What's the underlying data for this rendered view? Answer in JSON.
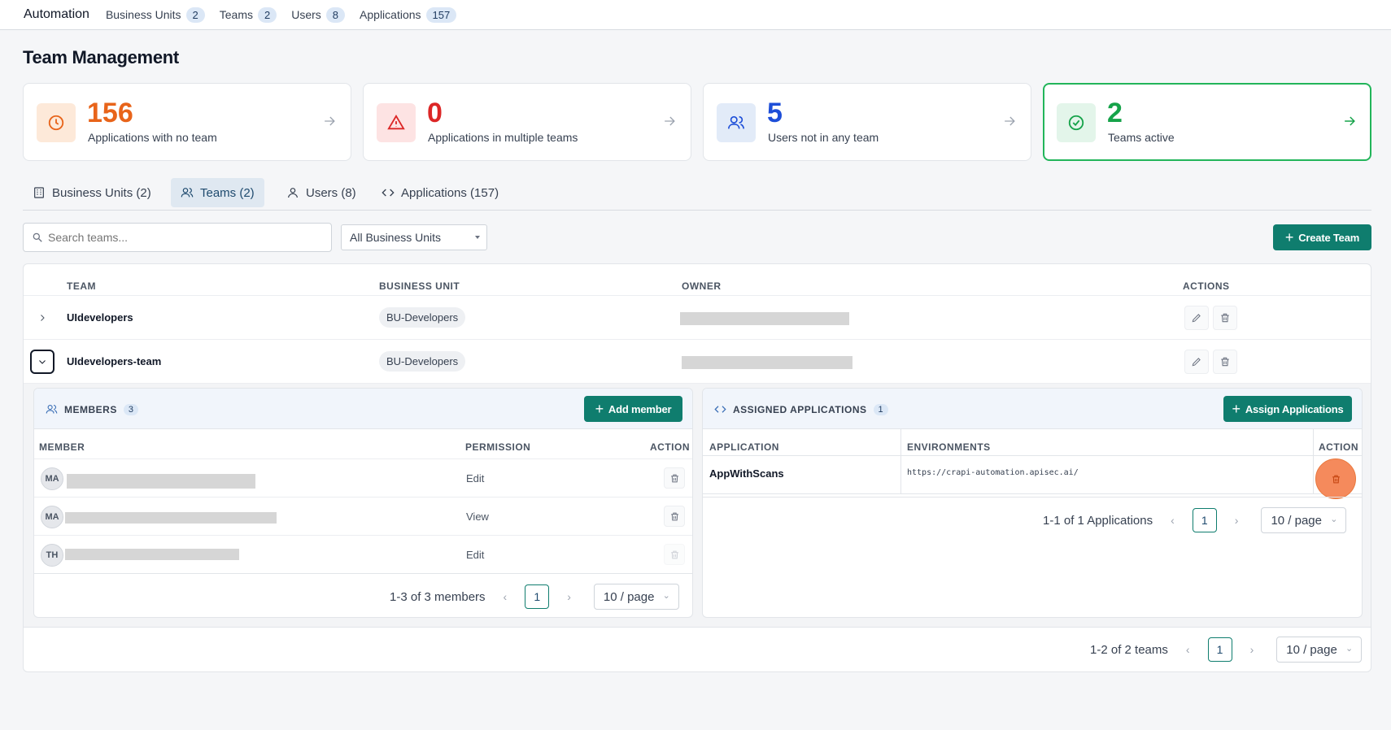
{
  "topnav": {
    "app_title": "Automation",
    "items": [
      {
        "label": "Business Units",
        "count": "2"
      },
      {
        "label": "Teams",
        "count": "2"
      },
      {
        "label": "Users",
        "count": "8"
      },
      {
        "label": "Applications",
        "count": "157"
      }
    ]
  },
  "page": {
    "title": "Team Management"
  },
  "stats": [
    {
      "value": "156",
      "label": "Applications with no team",
      "color": "#e8641a",
      "icon": "clock-icon"
    },
    {
      "value": "0",
      "label": "Applications in multiple teams",
      "color": "#dc2626",
      "icon": "warning-triangle-icon"
    },
    {
      "value": "5",
      "label": "Users not in any team",
      "color": "#1d4ed8",
      "icon": "users-icon"
    },
    {
      "value": "2",
      "label": "Teams active",
      "color": "#16a34a",
      "icon": "check-circle-icon"
    }
  ],
  "tabs": [
    {
      "label": "Business Units (2)",
      "icon": "building-icon"
    },
    {
      "label": "Teams (2)",
      "icon": "users-icon",
      "active": true
    },
    {
      "label": "Users (8)",
      "icon": "user-icon"
    },
    {
      "label": "Applications (157)",
      "icon": "code-icon"
    }
  ],
  "filters": {
    "search_placeholder": "Search teams...",
    "business_unit_selected": "All Business Units",
    "create_label": "Create Team"
  },
  "table": {
    "headers": {
      "team": "TEAM",
      "business_unit": "BUSINESS UNIT",
      "owner": "OWNER",
      "actions": "ACTIONS"
    },
    "rows": [
      {
        "team": "UIdevelopers",
        "business_unit": "BU-Developers",
        "expanded": false
      },
      {
        "team": "UIdevelopers-team",
        "business_unit": "BU-Developers",
        "expanded": true
      }
    ]
  },
  "members": {
    "title": "MEMBERS",
    "count": "3",
    "add_label": "Add member",
    "headers": {
      "member": "MEMBER",
      "permission": "PERMISSION",
      "action": "ACTION"
    },
    "rows": [
      {
        "initials": "MA",
        "permission": "Edit"
      },
      {
        "initials": "MA",
        "permission": "View"
      },
      {
        "initials": "TH",
        "permission": "Edit"
      }
    ],
    "pager": {
      "summary": "1-3 of 3 members",
      "page": "1",
      "per_page": "10 / page"
    }
  },
  "applications": {
    "title": "ASSIGNED APPLICATIONS",
    "count": "1",
    "assign_label": "Assign Applications",
    "headers": {
      "application": "APPLICATION",
      "environments": "ENVIRONMENTS",
      "action": "ACTION"
    },
    "rows": [
      {
        "name": "AppWithScans",
        "environment": "https://crapi-automation.apisec.ai/"
      }
    ],
    "pager": {
      "summary": "1-1 of 1 Applications",
      "page": "1",
      "per_page": "10 / page"
    }
  },
  "teams_pager": {
    "summary": "1-2 of 2 teams",
    "page": "1",
    "per_page": "10 / page"
  },
  "colors": {
    "accent": "#0f7d6e",
    "active_border": "#22b55a",
    "highlight": "#f58a5c"
  }
}
